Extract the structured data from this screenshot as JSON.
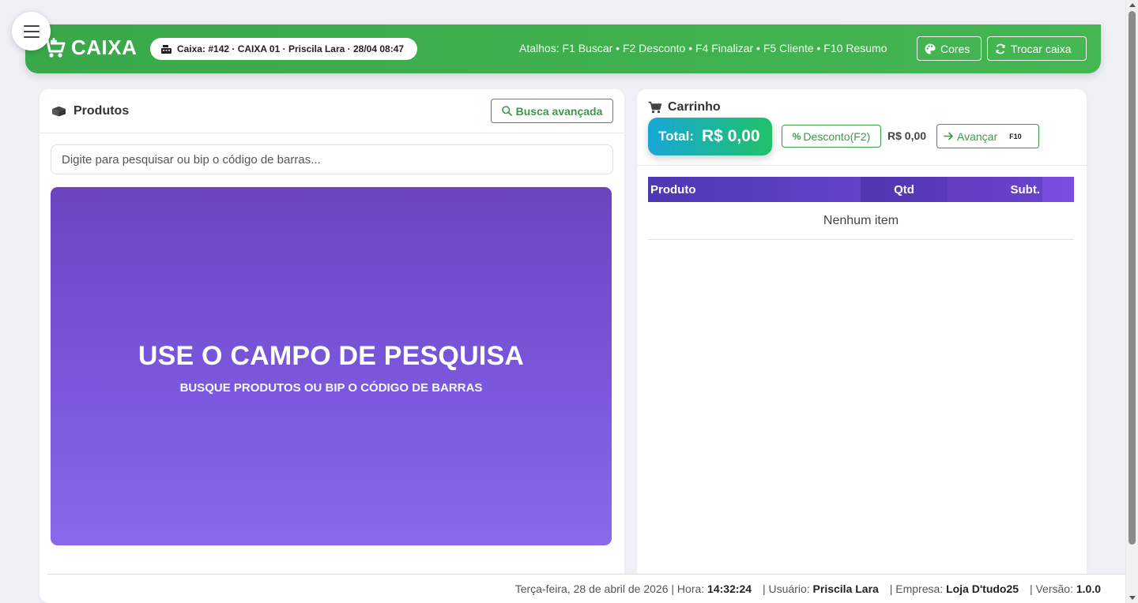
{
  "header": {
    "brand_title": "CAIXA",
    "caixa_info": "Caixa: #142 · CAIXA 01 · Priscila Lara · 28/04 08:47",
    "shortcuts": "Atalhos: F1 Buscar • F2 Desconto • F4 Finalizar • F5 Cliente • F10 Resumo",
    "cores_label": "Cores",
    "trocar_label": "Trocar caixa",
    "color": "#3aa84a"
  },
  "products": {
    "title": "Produtos",
    "busca_label": "Busca avançada",
    "search_placeholder": "Digite para pesquisar ou bip o código de barras...",
    "promo_title": "USE O CAMPO DE PESQUISA",
    "promo_subtitle": "BUSQUE PRODUTOS OU BIP O CÓDIGO DE BARRAS"
  },
  "cart": {
    "title": "Carrinho",
    "total_label": "Total:",
    "total_value": "R$ 0,00",
    "desconto_label": "Desconto(F2)",
    "desconto_value": "R$ 0,00",
    "avancar_label": "Avançar",
    "avancar_key": "F10",
    "columns": [
      "Produto",
      "Qtd",
      "Subt."
    ],
    "empty_text": "Nenhum item"
  },
  "footer": {
    "date": "Terça-feira, 28 de abril de 2026",
    "hora_label": "Hora:",
    "hora": "14:32:24",
    "usuario_label": "Usuário:",
    "usuario": "Priscila Lara",
    "empresa_label": "Empresa:",
    "empresa": "Loja D'tudo25",
    "versao_label": "Versão:",
    "versao": "1.0.0"
  },
  "icons": {
    "menu": "hamburger-icon",
    "brand": "cart-plus-icon",
    "register": "cash-register-icon",
    "palette": "palette-icon",
    "swap": "sync-icon",
    "products": "boxes-icon",
    "search": "search-icon",
    "cart": "cart-icon",
    "percent": "percent-icon",
    "arrow": "arrow-right-icon"
  }
}
